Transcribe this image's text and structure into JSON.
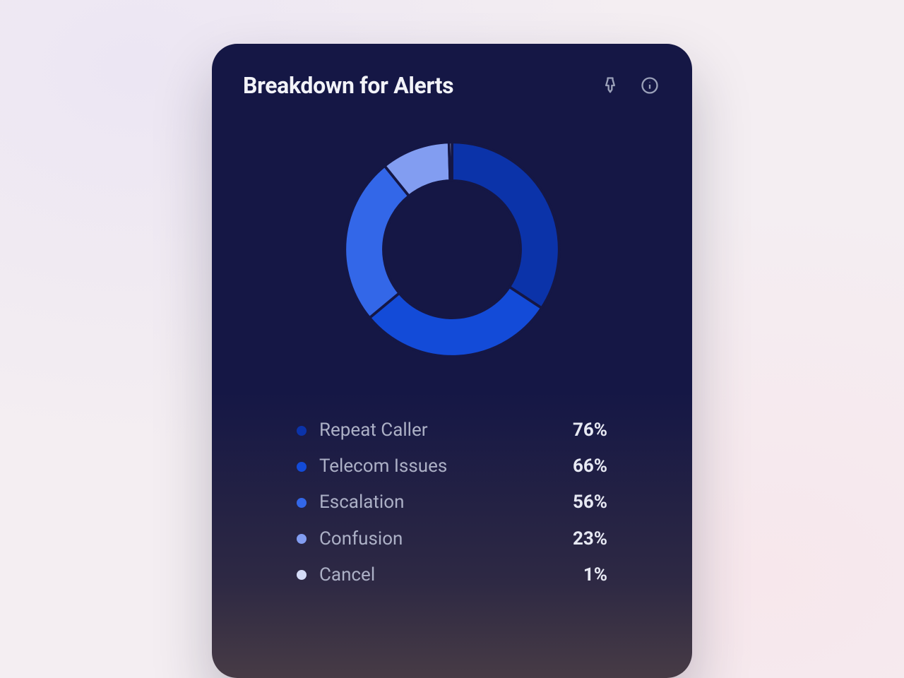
{
  "card": {
    "title": "Breakdown for Alerts"
  },
  "legend": {
    "items": [
      {
        "label": "Repeat Caller",
        "value": "76%",
        "color": "#0b33a9"
      },
      {
        "label": "Telecom Issues",
        "value": "66%",
        "color": "#134bd8"
      },
      {
        "label": "Escalation",
        "value": "56%",
        "color": "#3367e8"
      },
      {
        "label": "Confusion",
        "value": "23%",
        "color": "#829df1"
      },
      {
        "label": "Cancel",
        "value": "1%",
        "color": "#d5dcf7"
      }
    ]
  },
  "chart_data": {
    "type": "pie",
    "title": "Breakdown for Alerts",
    "categories": [
      "Repeat Caller",
      "Telecom Issues",
      "Escalation",
      "Confusion",
      "Cancel"
    ],
    "values": [
      76,
      66,
      56,
      23,
      1
    ],
    "colors": [
      "#0b33a9",
      "#134bd8",
      "#3367e8",
      "#829df1",
      "#d5dcf7"
    ],
    "donut": true,
    "donut_inner_ratio": 0.64,
    "background": "#151745",
    "gap_stroke": "#151745"
  }
}
